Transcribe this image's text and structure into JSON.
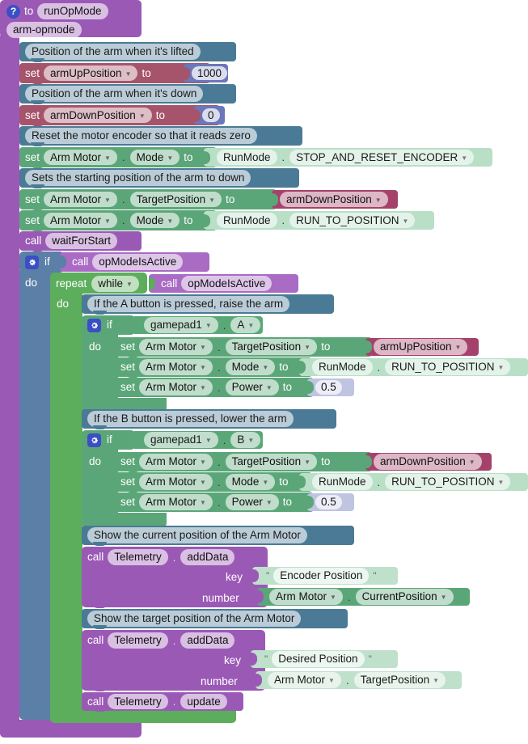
{
  "program": {
    "title": "runOpMode",
    "to_label": "to",
    "opmode_name": "arm-opmode",
    "help_icon": "question-icon"
  },
  "labels": {
    "set": "set",
    "to": "to",
    "call": "call",
    "if": "if",
    "do": "do",
    "repeat": "repeat",
    "key": "key",
    "number": "number",
    "dot": ".",
    "quote": "\""
  },
  "comments": {
    "arm_up": "Position of the arm when it's lifted",
    "arm_down": "Position of the arm when it's down",
    "reset_encoder": "Reset the motor encoder so that it reads zero",
    "start_down": "Sets the starting position of the arm to down",
    "a_button": "If the A button is pressed, raise the arm",
    "b_button": "If the B button is pressed, lower the arm",
    "show_current": "Show the current position of the Arm Motor",
    "show_target": "Show the target position of the Arm Motor"
  },
  "variables": {
    "arm_up": "armUpPosition",
    "arm_down": "armDownPosition",
    "arm_up_value": "1000",
    "arm_down_value": "0"
  },
  "devices": {
    "motor": "Arm Motor",
    "gamepad": "gamepad1",
    "telemetry": "Telemetry",
    "runmode_class": "RunMode"
  },
  "properties": {
    "mode": "Mode",
    "target_position": "TargetPosition",
    "current_position": "CurrentPosition",
    "power": "Power",
    "button_a": "A",
    "button_b": "B"
  },
  "enums": {
    "stop_and_reset": "STOP_AND_RESET_ENCODER",
    "run_to_position": "RUN_TO_POSITION"
  },
  "calls": {
    "wait_for_start": "waitForStart",
    "op_mode_is_active": "opModeIsActive",
    "add_data": "addData",
    "update": "update"
  },
  "loop": {
    "mode": "while"
  },
  "values": {
    "power_a": "0.5",
    "power_b": "0.5",
    "key_encoder": "Encoder Position",
    "key_desired": "Desired Position"
  },
  "colors": {
    "procedure": "#9b59b6",
    "comment": "#4a7a95",
    "variable_set": "#a5546b",
    "variable_get": "#a5426b",
    "motor": "#5ba678",
    "enum": "#b9dfc7",
    "number": "#6b77b8",
    "text": "#bfe0cb",
    "control": "#5b7fa6",
    "loop": "#5cad5c",
    "mutator_icon": "#3b4fc4"
  }
}
